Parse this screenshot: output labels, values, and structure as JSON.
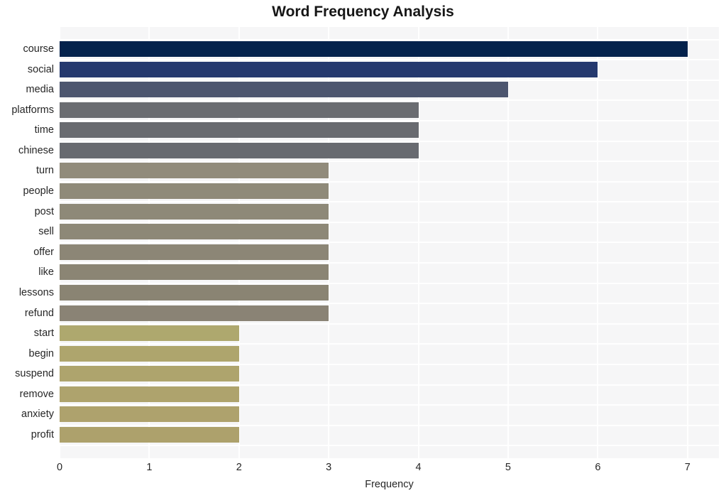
{
  "chart_data": {
    "type": "bar",
    "orientation": "horizontal",
    "title": "Word Frequency Analysis",
    "xlabel": "Frequency",
    "ylabel": "",
    "xlim": [
      0,
      7.35
    ],
    "ylim": null,
    "grid": true,
    "legend": false,
    "xticks": [
      "0",
      "1",
      "2",
      "3",
      "4",
      "5",
      "6",
      "7"
    ],
    "xtick_values": [
      0,
      1,
      2,
      3,
      4,
      5,
      6,
      7
    ],
    "categories": [
      "course",
      "social",
      "media",
      "platforms",
      "time",
      "chinese",
      "turn",
      "people",
      "post",
      "sell",
      "offer",
      "like",
      "lessons",
      "refund",
      "start",
      "begin",
      "suspend",
      "remove",
      "anxiety",
      "profit"
    ],
    "values": [
      7,
      6,
      5,
      4,
      4,
      4,
      3,
      3,
      3,
      3,
      3,
      3,
      3,
      3,
      2,
      2,
      2,
      2,
      2,
      2
    ],
    "bar_colors": [
      "#04224c",
      "#25396e",
      "#4d566f",
      "#6a6c71",
      "#696b70",
      "#686a70",
      "#918b7b",
      "#8f8a79",
      "#8e8978",
      "#8d8877",
      "#8c8676",
      "#8b8574",
      "#8a8473",
      "#8a8375",
      "#aea86e",
      "#aea56d",
      "#aea46d",
      "#aea36d",
      "#aea26d",
      "#ada16c"
    ],
    "plot_background": "#f6f6f7",
    "gridline_color": "#ffffff",
    "title_color": "#161616",
    "tick_color": "#262626"
  }
}
